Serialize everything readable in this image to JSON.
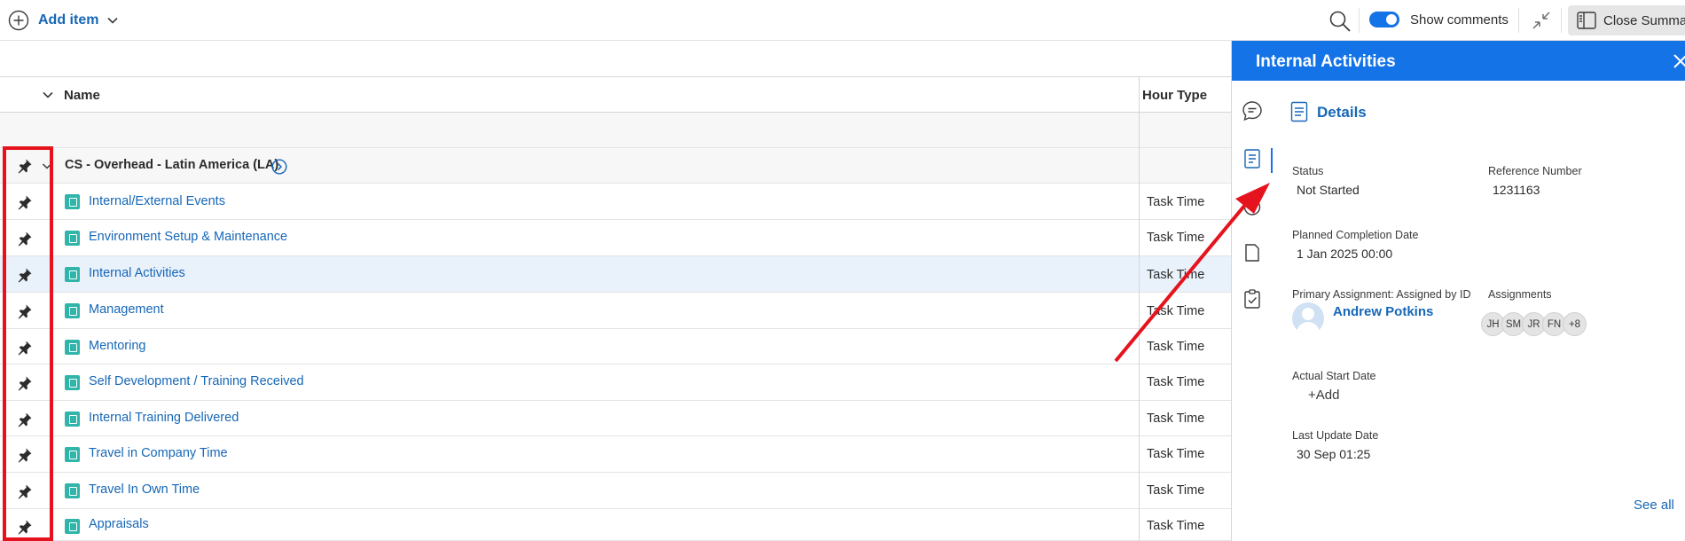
{
  "toolbar": {
    "add_item_label": "Add item",
    "show_comments_label": "Show comments",
    "show_comments_on": true,
    "close_summary_label": "Close Summary"
  },
  "table": {
    "columns": {
      "name": "Name",
      "hour_type": "Hour Type"
    },
    "group": {
      "name": "CS - Overhead - Latin America (LA)"
    },
    "rows": [
      {
        "name": "Internal/External Events",
        "hour_type": "Task Time"
      },
      {
        "name": "Environment Setup & Maintenance",
        "hour_type": "Task Time"
      },
      {
        "name": "Internal Activities",
        "hour_type": "Task Time"
      },
      {
        "name": "Management",
        "hour_type": "Task Time"
      },
      {
        "name": "Mentoring",
        "hour_type": "Task Time"
      },
      {
        "name": "Self Development / Training Received",
        "hour_type": "Task Time"
      },
      {
        "name": "Internal Training Delivered",
        "hour_type": "Task Time"
      },
      {
        "name": "Travel in Company Time",
        "hour_type": "Task Time"
      },
      {
        "name": "Travel In Own Time",
        "hour_type": "Task Time"
      },
      {
        "name": "Appraisals",
        "hour_type": "Task Time"
      }
    ]
  },
  "panel": {
    "title": "Internal Activities",
    "section_title": "Details",
    "status": {
      "label": "Status",
      "value": "Not Started"
    },
    "reference": {
      "label": "Reference Number",
      "value": "1231163"
    },
    "planned_completion": {
      "label": "Planned Completion Date",
      "value": "1 Jan 2025 00:00"
    },
    "primary_assignment": {
      "label": "Primary Assignment: Assigned by ID",
      "value": "Andrew Potkins"
    },
    "assignments": {
      "label": "Assignments",
      "initials": [
        "JH",
        "SM",
        "JR",
        "FN",
        "+8"
      ]
    },
    "actual_start": {
      "label": "Actual Start Date",
      "value": "+Add"
    },
    "last_update": {
      "label": "Last Update Date",
      "value": "30 Sep 01:25"
    },
    "see_all": "See all"
  },
  "colors": {
    "accent": "#1473e6",
    "link": "#1667b7",
    "task_icon": "#31b4a9",
    "annotation": "#e5131d",
    "selected_row": "#e9f1fb"
  }
}
